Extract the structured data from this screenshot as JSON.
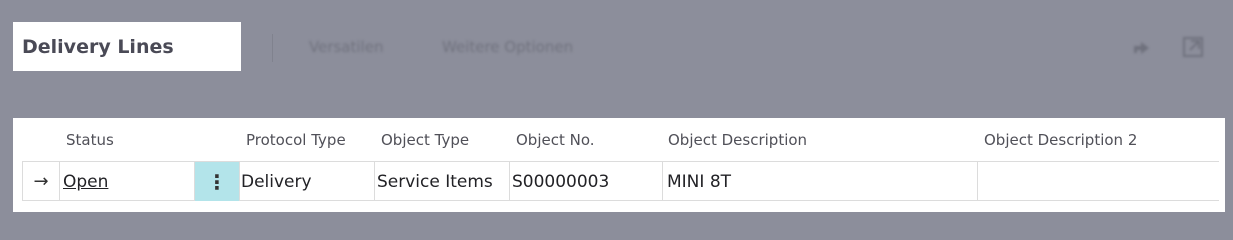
{
  "page": {
    "title": "Delivery Lines",
    "actions": [
      "Versatilen",
      "Weitere Optionen"
    ],
    "icons": [
      "share-icon",
      "open-in-new-window-icon"
    ]
  },
  "table": {
    "headers": {
      "status": "Status",
      "protocol_type": "Protocol Type",
      "object_type": "Object Type",
      "object_no": "Object No.",
      "object_description": "Object Description",
      "object_description_2": "Object Description 2"
    },
    "rows": [
      {
        "row_marker": "→",
        "status": "Open",
        "menu": "⋮",
        "protocol_type": "Delivery",
        "object_type": "Service Items",
        "object_no": "S00000003",
        "object_description": "MINI 8T",
        "object_description_2": ""
      }
    ]
  }
}
